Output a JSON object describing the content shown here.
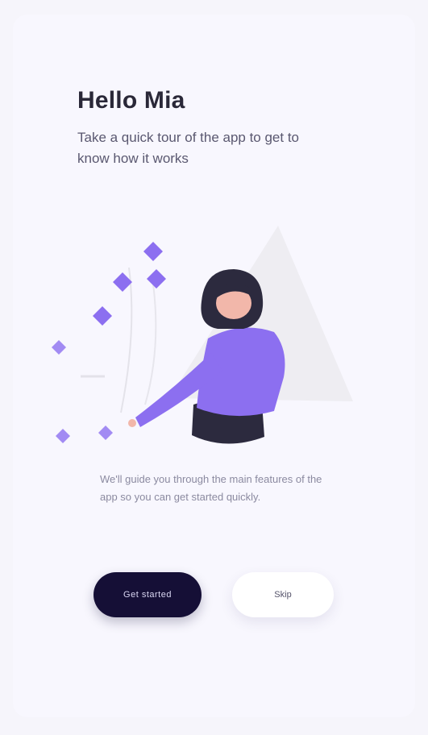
{
  "header": {
    "title": "Hello Mia",
    "subtitle": "Take a quick tour of the app to get to know how it works"
  },
  "description": "We'll guide you through the main features of the app so you can get started quickly.",
  "actions": {
    "primary_label": "Get started",
    "secondary_label": "Skip"
  },
  "colors": {
    "accent": "#8c6ff0",
    "primary_button": "#150f36",
    "background": "#f8f7fe"
  },
  "illustration": {
    "icon": "person-reaching-for-floating-elements-illustration"
  }
}
